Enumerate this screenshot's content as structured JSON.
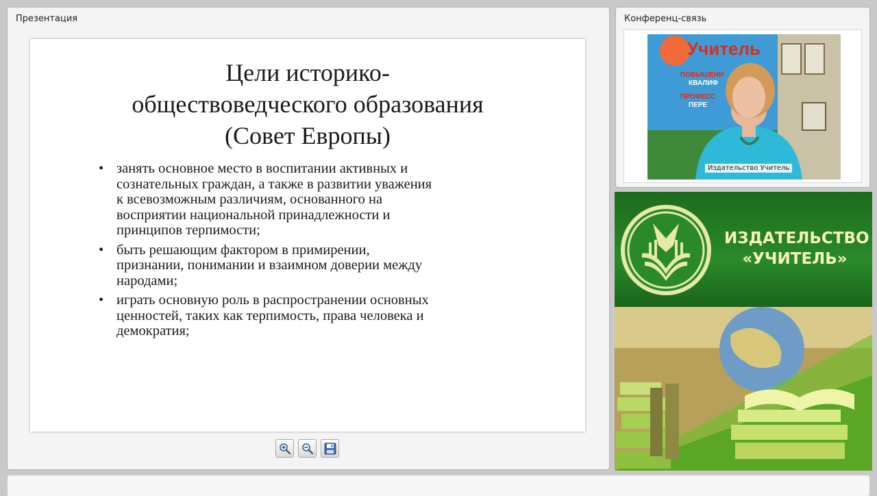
{
  "presentation": {
    "panel_title": "Презентация",
    "slide": {
      "title_lines": [
        "Цели историко-",
        "обществоведческого образования",
        "(Совет Европы)"
      ],
      "bullets": [
        {
          "lines": [
            "занять основное место в воспитании активных и",
            "сознательных граждан, а также в развитии уважения",
            "к всевозможным различиям, основанного на",
            "восприятии национальной принадлежности и",
            "принципов терпимости;"
          ]
        },
        {
          "lines": [
            "быть решающим фактором в примирении,",
            "признании, понимании и взаимном доверии между",
            "народами;"
          ]
        },
        {
          "lines": [
            "играть основную роль в распространении основных",
            "ценностей, таких как терпимость, права человека и",
            "демократия;"
          ]
        }
      ],
      "bullet_char": "•"
    },
    "toolbar": {
      "zoom_in_icon": "zoom-in-icon",
      "zoom_out_icon": "zoom-out-icon",
      "save_icon": "save-icon"
    }
  },
  "conference": {
    "panel_title": "Конференц-связь",
    "video_label": "Издательство Учитель",
    "backdrop": {
      "banner_text": "Учитель",
      "lines": [
        "ПОВЫШЕНИ",
        "КВАЛИФ",
        "ПРОФЕСС",
        "ПЕРЕ"
      ]
    }
  },
  "ad": {
    "name_lines": [
      "ИЗДАТЕЛЬСТВО",
      "«УЧИТЕЛЬ»"
    ],
    "colors": {
      "green": "#1d6b1d",
      "text": "#f6f3b8"
    }
  }
}
